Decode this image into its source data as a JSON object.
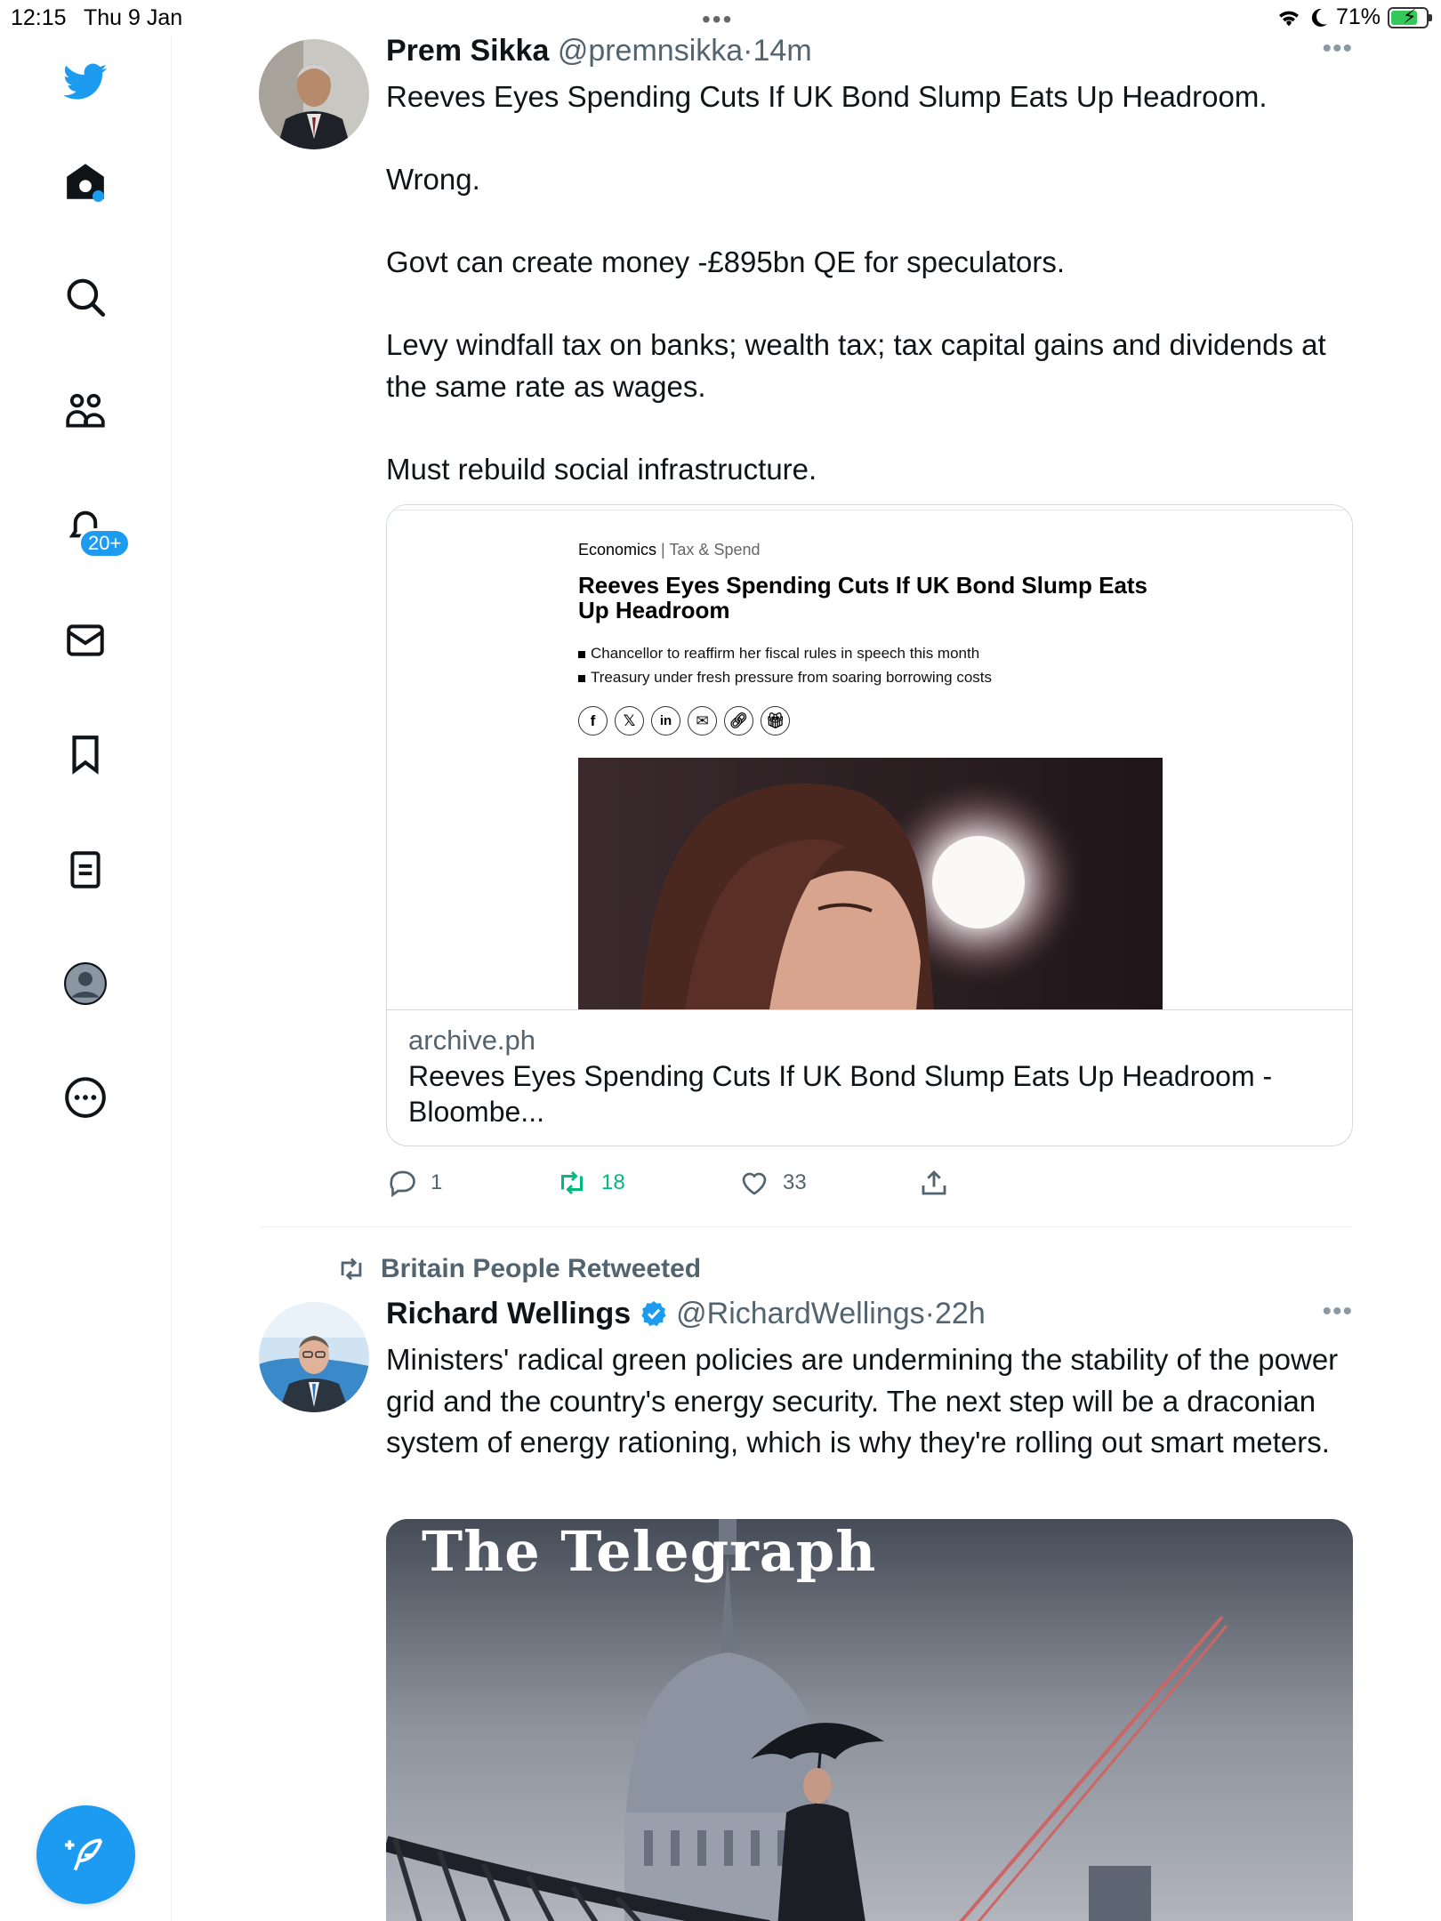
{
  "status_bar": {
    "time": "12:15",
    "date": "Thu 9 Jan",
    "battery": "71%"
  },
  "sidebar": {
    "notifications_badge": "20+",
    "items": [
      {
        "name": "home"
      },
      {
        "name": "search"
      },
      {
        "name": "communities"
      },
      {
        "name": "notifications"
      },
      {
        "name": "messages"
      },
      {
        "name": "bookmarks"
      },
      {
        "name": "lists"
      },
      {
        "name": "profile"
      },
      {
        "name": "more"
      }
    ]
  },
  "tweets": [
    {
      "author_name": "Prem Sikka",
      "handle": "@premnsikka",
      "time": "14m",
      "text": [
        "Reeves Eyes Spending Cuts If UK Bond Slump Eats Up Headroom.",
        "Wrong.",
        "Govt can create money -£895bn QE for speculators.",
        "Levy windfall tax on banks; wealth tax; tax capital gains and dividends at the same rate as wages.",
        "Must rebuild social infrastructure."
      ],
      "card": {
        "kicker": "Economics",
        "kicker_sub": "Tax & Spend",
        "headline": "Reeves Eyes Spending Cuts If UK Bond Slump Eats Up Headroom",
        "bullets": [
          "Chancellor to reaffirm her fiscal rules in speech this month",
          "Treasury under fresh pressure from soaring borrowing costs"
        ],
        "domain": "archive.ph",
        "title": "Reeves Eyes Spending Cuts If UK Bond Slump Eats Up Headroom - Bloombe..."
      },
      "stats": {
        "replies": "1",
        "retweets": "18",
        "likes": "33"
      }
    },
    {
      "retweeted_by": "Britain People Retweeted",
      "author_name": "Richard Wellings",
      "verified": true,
      "handle": "@RichardWellings",
      "time": "22h",
      "text": "Ministers' radical green policies are undermining the stability of the power grid and the country's energy security. The next step will be a draconian system of energy rationing, which is why they're rolling out smart meters.",
      "media_masthead": "The Telegraph"
    }
  ],
  "colors": {
    "accent": "#1d9bf0",
    "retweet": "#00ba7c",
    "secondary_text": "#536471"
  }
}
